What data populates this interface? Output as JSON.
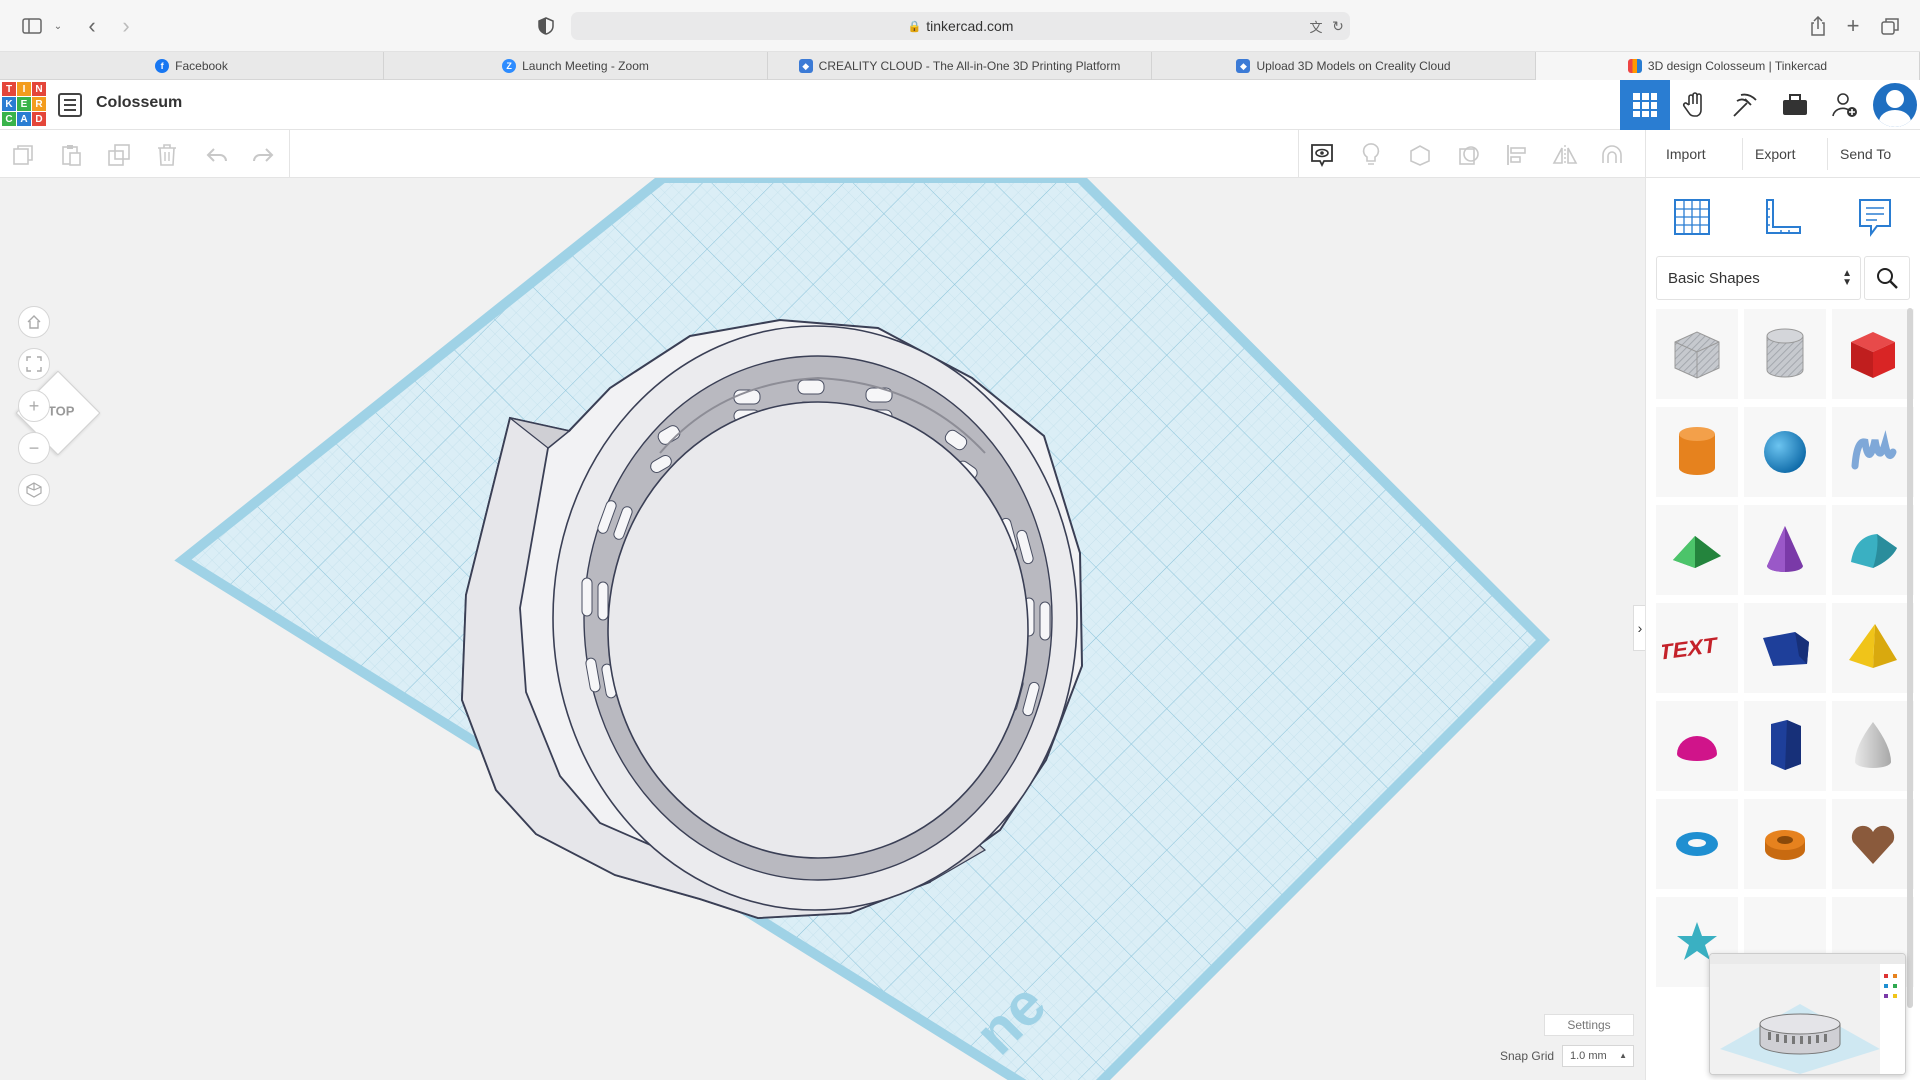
{
  "browser": {
    "url": "tinkercad.com",
    "tabs": [
      {
        "label": "Facebook",
        "favicon": "facebook-icon",
        "color": "#1877f2"
      },
      {
        "label": "Launch Meeting - Zoom",
        "favicon": "zoom-icon",
        "color": "#2d8cff"
      },
      {
        "label": "CREALITY CLOUD - The All-in-One 3D Printing Platform",
        "favicon": "creality-icon",
        "color": "#3c7bd6"
      },
      {
        "label": "Upload 3D Models on Creality Cloud",
        "favicon": "creality-icon",
        "color": "#3c7bd6"
      },
      {
        "label": "3D design Colosseum | Tinkercad",
        "favicon": "tinkercad-icon",
        "color": "#e44"
      }
    ]
  },
  "app": {
    "logo_letters": [
      "T",
      "I",
      "N",
      "K",
      "E",
      "R",
      "C",
      "A",
      "D"
    ],
    "design_title": "Colosseum"
  },
  "toolbar": {
    "import_label": "Import",
    "export_label": "Export",
    "send_to_label": "Send To"
  },
  "viewport": {
    "viewcube_label": "TOP",
    "settings_label": "Settings",
    "snap_grid_label": "Snap Grid",
    "snap_grid_value": "1.0 mm"
  },
  "panel": {
    "category": "Basic Shapes",
    "shapes": [
      {
        "name": "box-hole",
        "color": "#b9bdc4"
      },
      {
        "name": "cylinder-hole",
        "color": "#c4c7cc"
      },
      {
        "name": "box",
        "color": "#d92525"
      },
      {
        "name": "cylinder",
        "color": "#e6821e"
      },
      {
        "name": "sphere",
        "color": "#1f8fd1"
      },
      {
        "name": "scribble",
        "color": "#7fa8d8"
      },
      {
        "name": "roof",
        "color": "#2fa84f"
      },
      {
        "name": "cone",
        "color": "#7a3aa8"
      },
      {
        "name": "round-roof",
        "color": "#3ab0c2"
      },
      {
        "name": "text",
        "color": "#c4222a"
      },
      {
        "name": "wedge",
        "color": "#1e3f9a"
      },
      {
        "name": "pyramid",
        "color": "#f0c419"
      },
      {
        "name": "half-sphere",
        "color": "#d0148a"
      },
      {
        "name": "polygon",
        "color": "#1e3f9a"
      },
      {
        "name": "paraboloid",
        "color": "#c8c8c8"
      },
      {
        "name": "torus",
        "color": "#1f8fd1"
      },
      {
        "name": "tube",
        "color": "#e6821e"
      },
      {
        "name": "heart",
        "color": "#8a5a3c"
      },
      {
        "name": "star",
        "color": "#3ab0c2"
      }
    ]
  }
}
